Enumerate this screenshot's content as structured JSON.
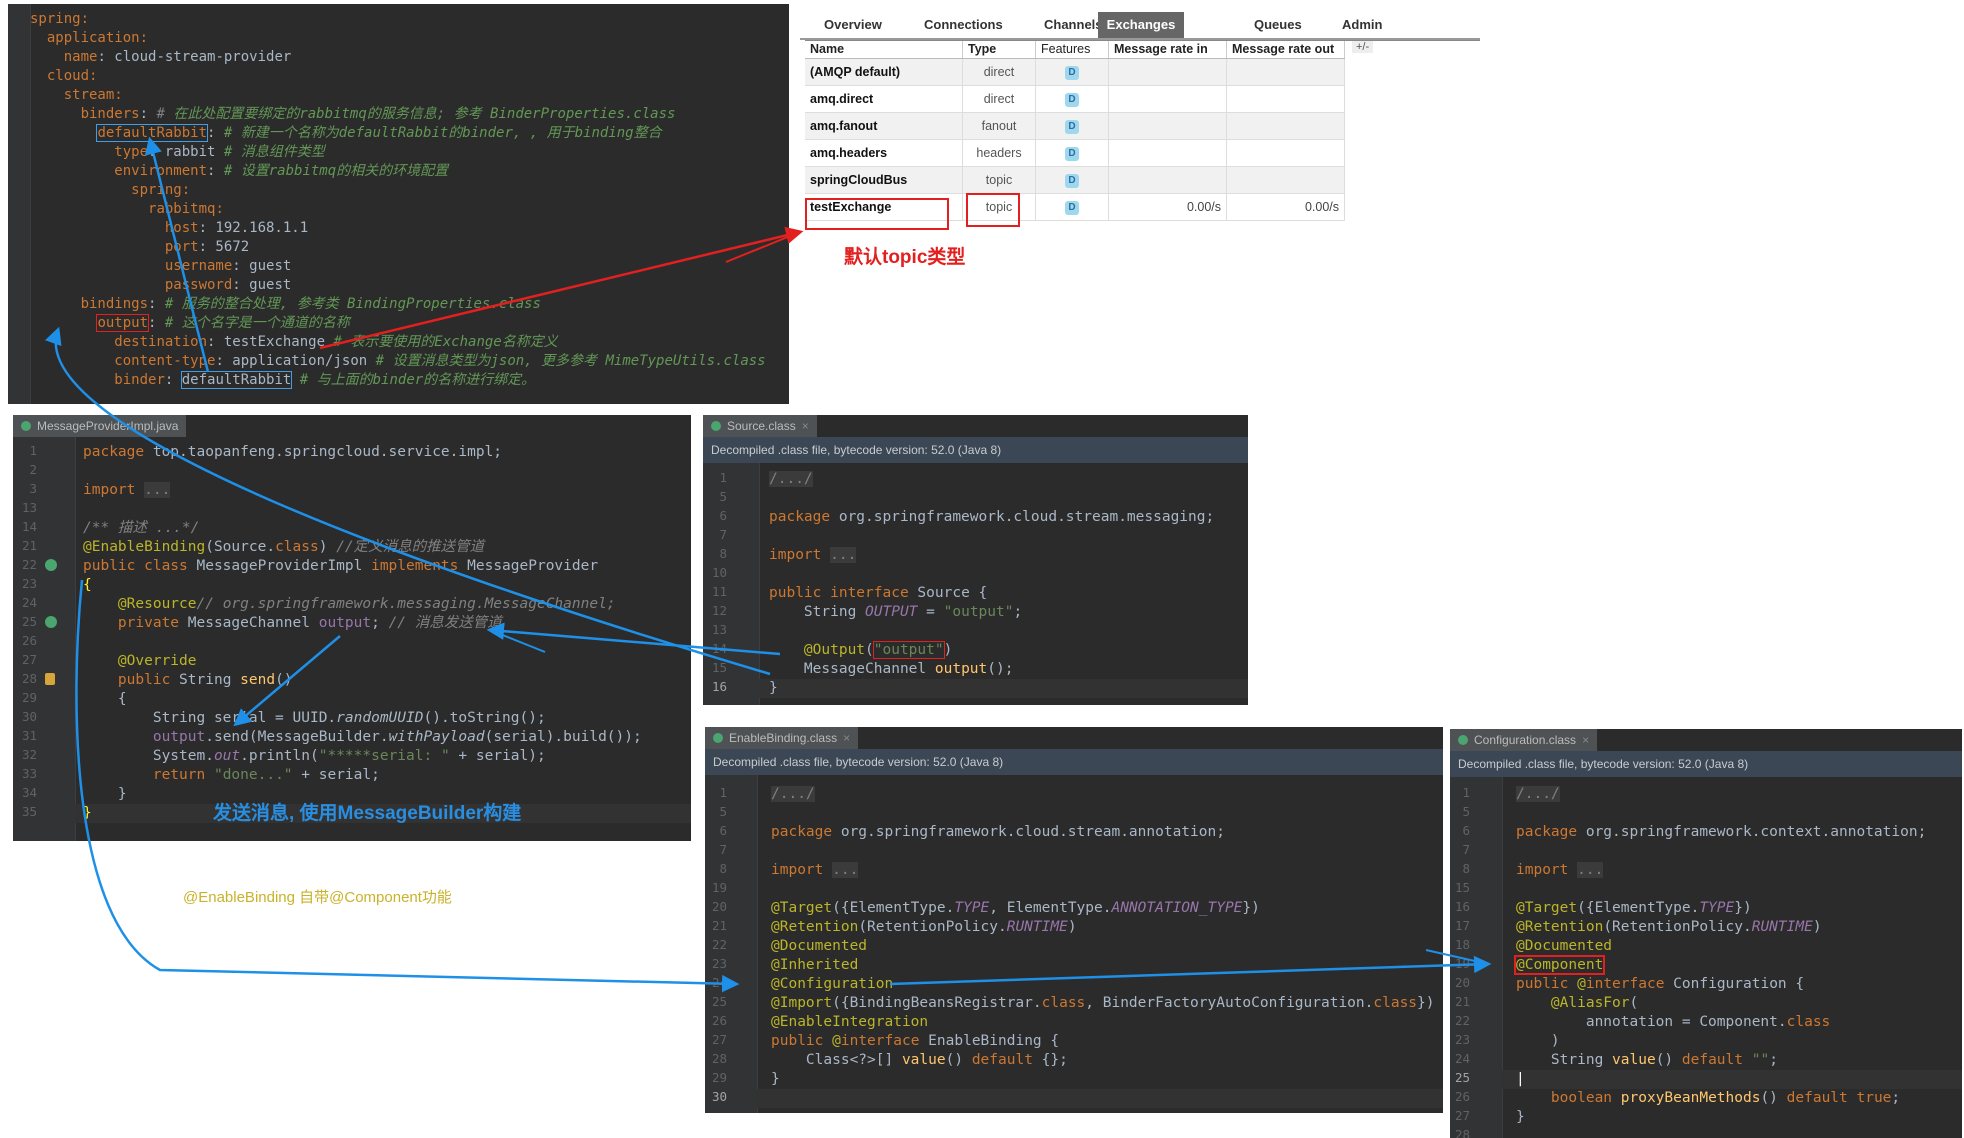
{
  "yaml": {
    "lines": [
      "spring:",
      "  application:",
      "    name: cloud-stream-provider",
      "  cloud:",
      "    stream:",
      "      binders: # 在此处配置要绑定的rabbitmq的服务信息; 参考 BinderProperties.class",
      "        defaultRabbit: # 新建一个名称为defaultRabbit的binder, , 用于binding整合",
      "          type: rabbit # 消息组件类型",
      "          environment: # 设置rabbitmq的相关的环境配置",
      "            spring:",
      "              rabbitmq:",
      "                host: 192.168.1.1",
      "                port: 5672",
      "                username: guest",
      "                password: guest",
      "      bindings: # 服务的整合处理, 参考类 BindingProperties.class",
      "        output: # 这个名字是一个通道的名称",
      "          destination: testExchange # 表示要使用的Exchange名称定义",
      "          content-type: application/json # 设置消息类型为json, 更多参考 MimeTypeUtils.class",
      "          binder: defaultRabbit # 与上面的binder的名称进行绑定。"
    ]
  },
  "rabbitmq": {
    "tabs": [
      "Overview",
      "Connections",
      "Channels",
      "Exchanges",
      "Queues",
      "Admin"
    ],
    "active_tab": "Exchanges",
    "columns": [
      "Name",
      "Type",
      "Features",
      "Message rate in",
      "Message rate out",
      "+/-"
    ],
    "rows": [
      {
        "name": "(AMQP default)",
        "type": "direct",
        "feature": "D",
        "rate_in": "",
        "rate_out": ""
      },
      {
        "name": "amq.direct",
        "type": "direct",
        "feature": "D",
        "rate_in": "",
        "rate_out": ""
      },
      {
        "name": "amq.fanout",
        "type": "fanout",
        "feature": "D",
        "rate_in": "",
        "rate_out": ""
      },
      {
        "name": "amq.headers",
        "type": "headers",
        "feature": "D",
        "rate_in": "",
        "rate_out": ""
      },
      {
        "name": "springCloudBus",
        "type": "topic",
        "feature": "D",
        "rate_in": "",
        "rate_out": ""
      },
      {
        "name": "testExchange",
        "type": "topic",
        "feature": "D",
        "rate_in": "0.00/s",
        "rate_out": "0.00/s"
      }
    ],
    "caption": "默认topic类型"
  },
  "provider": {
    "tab": "MessageProviderImpl.java",
    "line_numbers": [
      "1",
      "2",
      "3",
      "13",
      "14",
      "21",
      "22",
      "23",
      "24",
      "25",
      "26",
      "27",
      "28",
      "29",
      "30",
      "31",
      "32",
      "33",
      "34",
      "35"
    ],
    "caption": "发送消息, 使用MessageBuilder构建"
  },
  "source": {
    "tab": "Source.class",
    "banner": "Decompiled .class file, bytecode version: 52.0 (Java 8)",
    "line_numbers": [
      "1",
      "5",
      "6",
      "7",
      "8",
      "10",
      "11",
      "12",
      "13",
      "14",
      "15",
      "16"
    ]
  },
  "enable_binding": {
    "tab": "EnableBinding.class",
    "banner": "Decompiled .class file, bytecode version: 52.0 (Java 8)",
    "line_numbers": [
      "1",
      "5",
      "6",
      "7",
      "8",
      "19",
      "20",
      "21",
      "22",
      "23",
      "24",
      "25",
      "26",
      "27",
      "28",
      "29",
      "30"
    ]
  },
  "configuration": {
    "tab": "Configuration.class",
    "banner": "Decompiled .class file, bytecode version: 52.0 (Java 8)",
    "line_numbers": [
      "1",
      "5",
      "6",
      "7",
      "8",
      "15",
      "16",
      "17",
      "18",
      "19",
      "20",
      "21",
      "22",
      "23",
      "24",
      "25",
      "26",
      "27",
      "28"
    ]
  },
  "annotations": {
    "component_note": "@EnableBinding 自带@Component功能"
  },
  "colors": {
    "arrow_red": "#e32020",
    "arrow_blue": "#1e90e8",
    "editor_bg": "#2b2b2b",
    "caption_blue": "#2a8ee0",
    "caption_yellow": "#c9b22a"
  }
}
